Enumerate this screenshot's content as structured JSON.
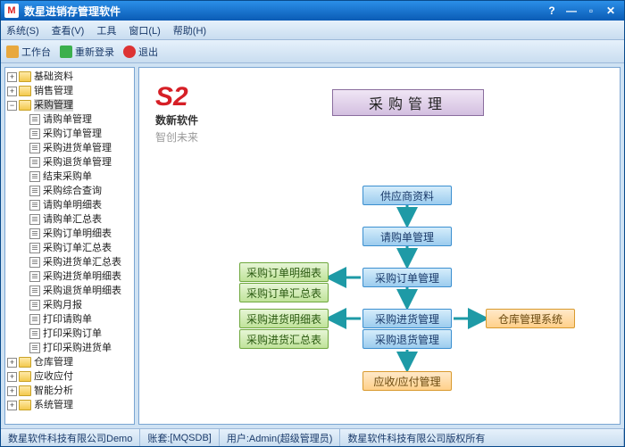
{
  "title": "数星进销存管理软件",
  "menu": {
    "system": "系统(S)",
    "view": "查看(V)",
    "tools": "工具",
    "window": "窗口(L)",
    "help": "帮助(H)"
  },
  "toolbar": {
    "workbench": "工作台",
    "relogin": "重新登录",
    "exit": "退出"
  },
  "tree": {
    "root0": "基础资料",
    "root1": "销售管理",
    "root2": "采购管理",
    "c": [
      "请购单管理",
      "采购订单管理",
      "采购进货单管理",
      "采购退货单管理",
      "结束采购单",
      "采购综合查询",
      "请购单明细表",
      "请购单汇总表",
      "采购订单明细表",
      "采购订单汇总表",
      "采购进货单汇总表",
      "采购进货单明细表",
      "采购退货单明细表",
      "采购月报",
      "打印请购单",
      "打印采购订单",
      "打印采购进货单"
    ],
    "root3": "仓库管理",
    "root4": "应收应付",
    "root5": "智能分析",
    "root6": "系统管理"
  },
  "brand": {
    "s2": "S2",
    "l1": "数新软件",
    "l2": "智创未来"
  },
  "header": "采购管理",
  "flow": {
    "supplier": "供应商资料",
    "req": "请购单管理",
    "po": "采购订单管理",
    "receipt": "采购进货管理",
    "return": "采购退货管理",
    "ap": "应收/应付管理",
    "podetail": "采购订单明细表",
    "posummary": "采购订单汇总表",
    "recdetail": "采购进货明细表",
    "recsummary": "采购进货汇总表",
    "warehouse": "仓库管理系统"
  },
  "status": {
    "company": "数星软件科技有限公司Demo",
    "setlabel": "账套:",
    "set": "[MQSDB]",
    "userlabel": "用户:",
    "user": "Admin(超级管理员)",
    "copyright": "数星软件科技有限公司版权所有"
  }
}
